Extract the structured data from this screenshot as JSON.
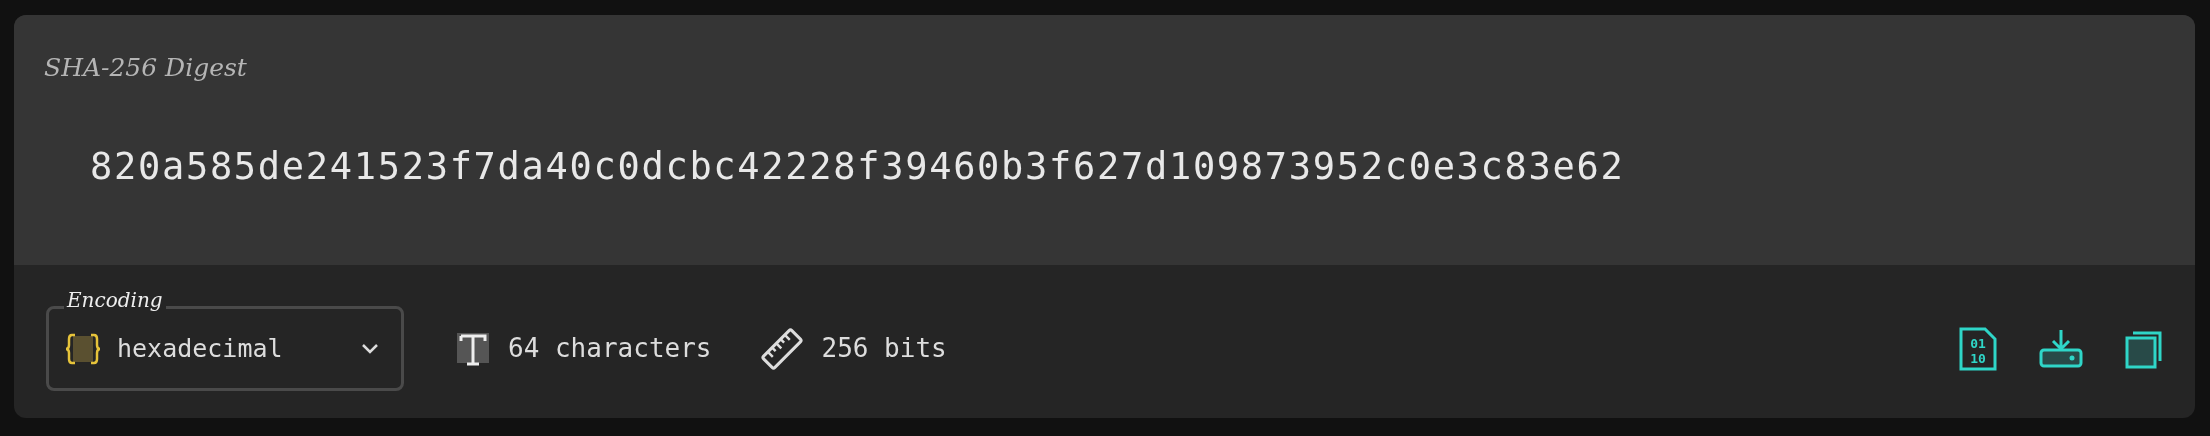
{
  "panel": {
    "title": "SHA-256 Digest",
    "digest": "820a585de241523f7da40c0dcbc42228f39460b3f627d109873952c0e3c83e62"
  },
  "encoding": {
    "label": "Encoding",
    "value": "hexadecimal"
  },
  "stats": [
    {
      "kind": "characters",
      "text": "64 characters"
    },
    {
      "kind": "bits",
      "text": "256 bits"
    }
  ],
  "actions": [
    {
      "kind": "binary",
      "glyphs": [
        "01",
        "10"
      ]
    },
    {
      "kind": "download"
    },
    {
      "kind": "copy"
    }
  ]
}
